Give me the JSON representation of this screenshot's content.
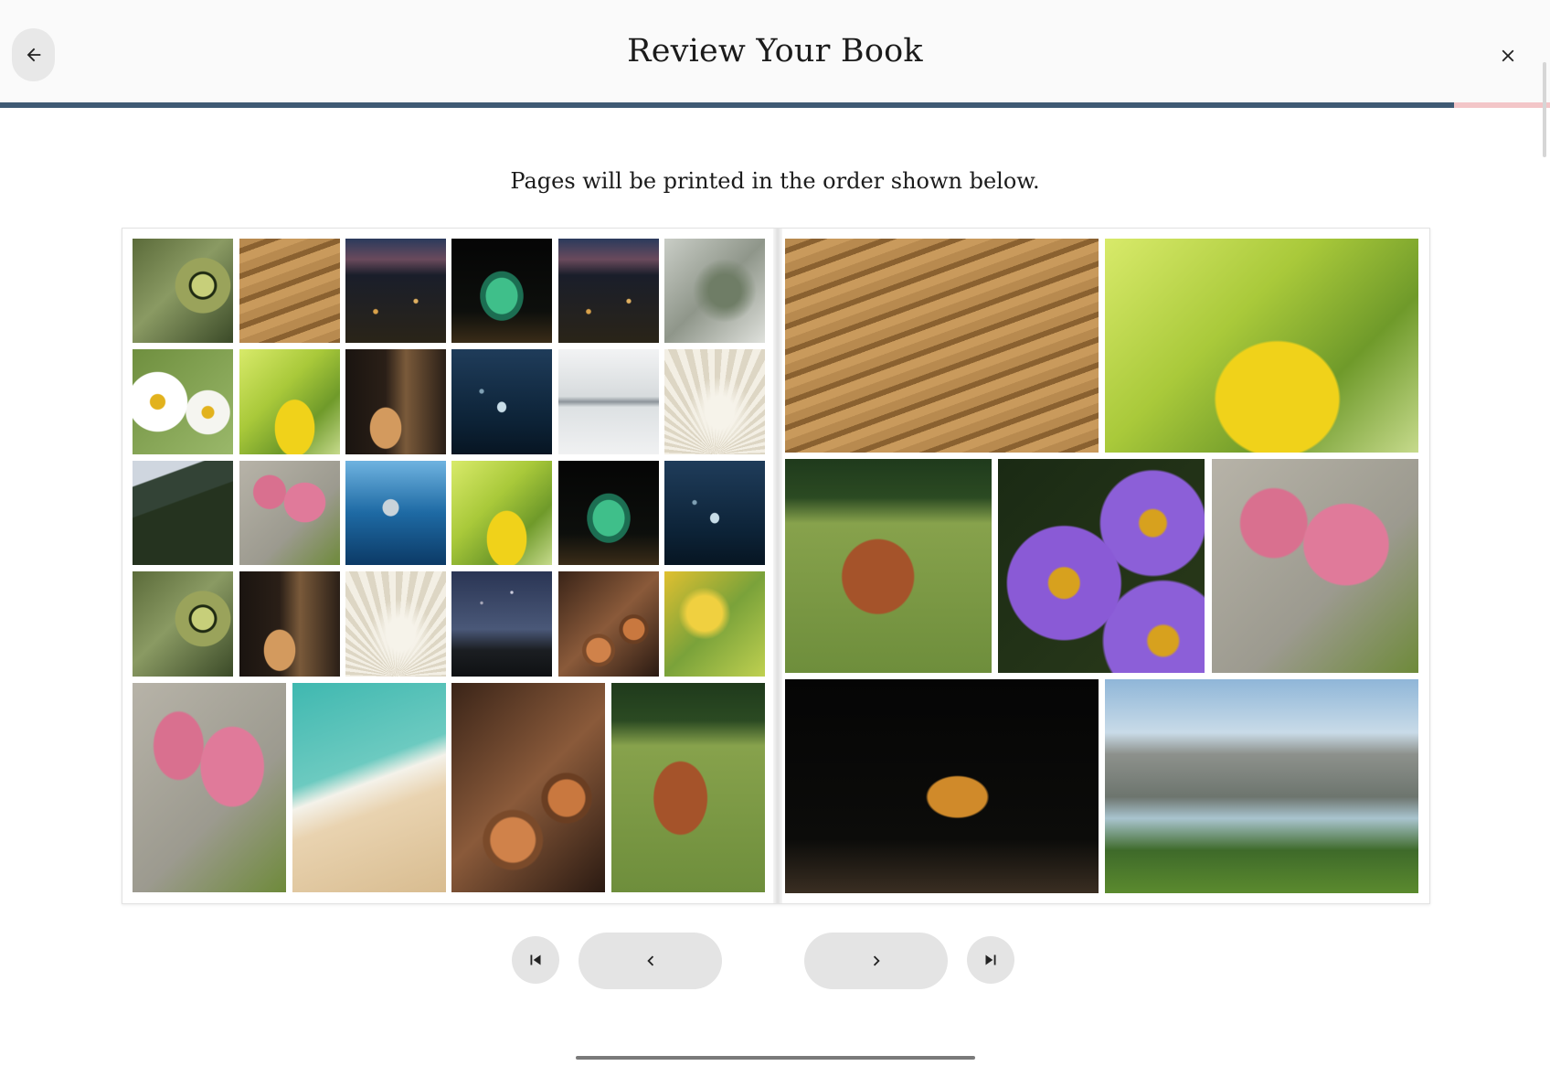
{
  "header": {
    "title": "Review Your Book",
    "back_icon": "arrow-left-icon",
    "close_icon": "close-icon"
  },
  "progress": {
    "fraction": 0.938,
    "fill_color": "#3f5a74",
    "track_color": "#f3c6c8"
  },
  "subtitle": "Pages will be printed in the order shown below.",
  "left_page": {
    "photos": [
      "lizard-eye",
      "sand-dunes",
      "city-night",
      "chameleon",
      "city-night",
      "pine-branch",
      "daisy",
      "sunflower",
      "cat",
      "fish-school",
      "winter-lake",
      "white-peacock",
      "mountain-forest",
      "pink-tulips",
      "shark",
      "sunflower",
      "chameleon",
      "fish-school",
      "lizard-eye",
      "cat",
      "white-peacock",
      "milky-way",
      "firewood",
      "yellow-tree",
      "pink-tulips",
      "beach",
      "firewood",
      "cow"
    ]
  },
  "right_page": {
    "photos": [
      "sand-dunes",
      "sunflower",
      "cow",
      "purple-asters",
      "pink-tulips",
      "tiger",
      "mountain-lake"
    ]
  },
  "controls": {
    "first_icon": "skip-to-first-icon",
    "prev_icon": "chevron-left-icon",
    "next_icon": "chevron-right-icon",
    "last_icon": "skip-to-last-icon"
  }
}
